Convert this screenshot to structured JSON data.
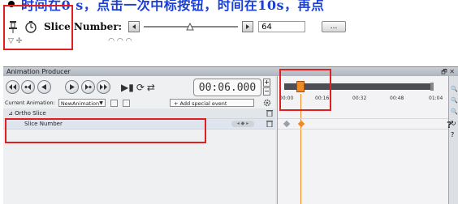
{
  "caption": {
    "text": "时间在0 s，点击一次中标按钮，时间在10s，再点"
  },
  "slice_toolbar": {
    "label": "Slice Number:",
    "value": "64",
    "more_button": "...",
    "icons": [
      "pin-icon",
      "clock-icon",
      "step-back-icon",
      "step-forward-icon"
    ]
  },
  "panel": {
    "title": "Animation Producer",
    "time": "00:06.000",
    "current_animation_label": "Current Animation:",
    "current_animation_value": "NewAnimation",
    "add_event_label": "+ Add special event",
    "tree": {
      "group": "Ortho Slice",
      "child": "Slice Number"
    },
    "timeline": {
      "ticks": [
        "00:00",
        "00:16",
        "00:32",
        "00:48",
        "01:04"
      ],
      "current_tick": "00:06"
    }
  },
  "colors": {
    "caption_blue": "#1a3fd6",
    "highlight_red": "#e02020",
    "time_handle_orange": "#f08a26",
    "timeline_bar": "#4d4f55"
  }
}
